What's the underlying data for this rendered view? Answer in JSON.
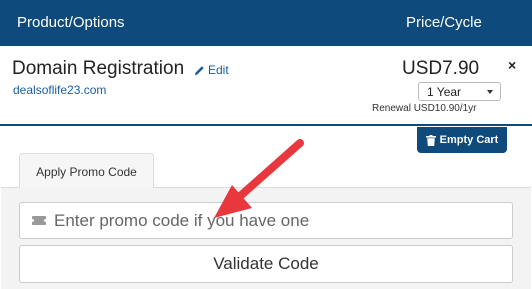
{
  "cart": {
    "header": {
      "product_label": "Product/Options",
      "price_label": "Price/Cycle"
    },
    "item": {
      "name": "Domain Registration",
      "edit_label": "Edit",
      "domain": "dealsoflife23.com",
      "price": "USD7.90",
      "billing_cycle": "1 Year",
      "renewal": "Renewal USD10.90/1yr",
      "remove_glyph": "×"
    },
    "empty_cart_label": "Empty Cart"
  },
  "promo": {
    "tab_label": "Apply Promo Code",
    "input_placeholder": "Enter promo code if you have one",
    "input_value": "",
    "validate_label": "Validate Code"
  },
  "colors": {
    "header_bg": "#0e4a7b",
    "link": "#1a5d9e",
    "arrow": "#e8383d",
    "panel_bg": "#f3f3f3"
  },
  "icons": {
    "edit": "pencil-icon",
    "empty_cart": "trash-icon",
    "promo": "ticket-icon",
    "annotation": "red-arrow"
  }
}
